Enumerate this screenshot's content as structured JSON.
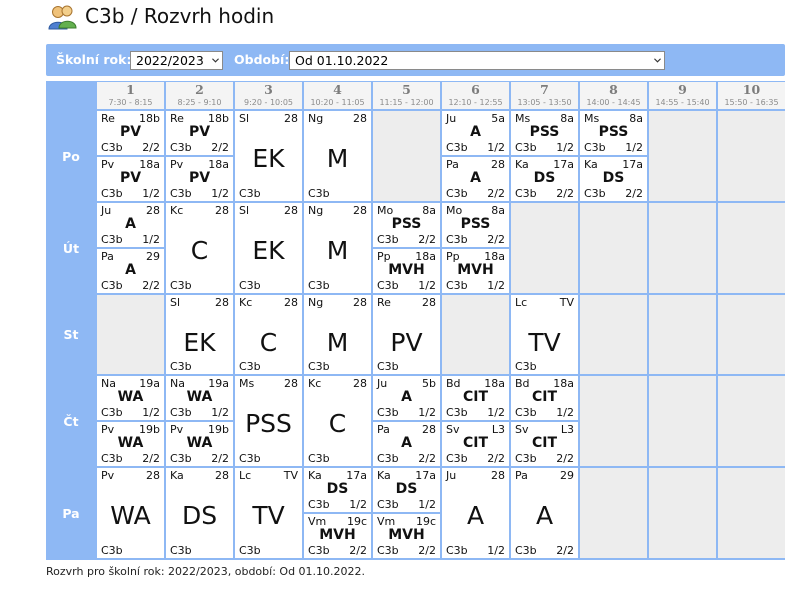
{
  "header": {
    "title": "C3b / Rozvrh hodin",
    "icon": "users-icon"
  },
  "filter": {
    "year_label": "Školní rok:",
    "year_value": "2022/2023",
    "period_label": "Období:",
    "period_value": "Od 01.10.2022"
  },
  "periods": [
    {
      "num": "1",
      "time": "7:30 - 8:15"
    },
    {
      "num": "2",
      "time": "8:25 - 9:10"
    },
    {
      "num": "3",
      "time": "9:20 - 10:05"
    },
    {
      "num": "4",
      "time": "10:20 - 11:05"
    },
    {
      "num": "5",
      "time": "11:15 - 12:00"
    },
    {
      "num": "6",
      "time": "12:10 - 12:55"
    },
    {
      "num": "7",
      "time": "13:05 - 13:50"
    },
    {
      "num": "8",
      "time": "14:00 - 14:45"
    },
    {
      "num": "9",
      "time": "14:55 - 15:40"
    },
    {
      "num": "10",
      "time": "15:50 - 16:35"
    }
  ],
  "days": [
    {
      "name": "Po",
      "slots": [
        [
          {
            "teacher": "Re",
            "room": "18b",
            "subject": "PV",
            "class": "C3b",
            "group": "2/2"
          },
          {
            "teacher": "Pv",
            "room": "18a",
            "subject": "PV",
            "class": "C3b",
            "group": "1/2"
          }
        ],
        [
          {
            "teacher": "Re",
            "room": "18b",
            "subject": "PV",
            "class": "C3b",
            "group": "2/2"
          },
          {
            "teacher": "Pv",
            "room": "18a",
            "subject": "PV",
            "class": "C3b",
            "group": "1/2"
          }
        ],
        [
          {
            "teacher": "Sl",
            "room": "28",
            "subject": "EK",
            "class": "C3b",
            "group": ""
          }
        ],
        [
          {
            "teacher": "Ng",
            "room": "28",
            "subject": "M",
            "class": "C3b",
            "group": ""
          }
        ],
        [],
        [
          {
            "teacher": "Ju",
            "room": "5a",
            "subject": "A",
            "class": "C3b",
            "group": "1/2"
          },
          {
            "teacher": "Pa",
            "room": "28",
            "subject": "A",
            "class": "C3b",
            "group": "2/2"
          }
        ],
        [
          {
            "teacher": "Ms",
            "room": "8a",
            "subject": "PSS",
            "class": "C3b",
            "group": "1/2"
          },
          {
            "teacher": "Ka",
            "room": "17a",
            "subject": "DS",
            "class": "C3b",
            "group": "2/2"
          }
        ],
        [
          {
            "teacher": "Ms",
            "room": "8a",
            "subject": "PSS",
            "class": "C3b",
            "group": "1/2"
          },
          {
            "teacher": "Ka",
            "room": "17a",
            "subject": "DS",
            "class": "C3b",
            "group": "2/2"
          }
        ],
        [],
        []
      ]
    },
    {
      "name": "Út",
      "slots": [
        [
          {
            "teacher": "Ju",
            "room": "28",
            "subject": "A",
            "class": "C3b",
            "group": "1/2"
          },
          {
            "teacher": "Pa",
            "room": "29",
            "subject": "A",
            "class": "C3b",
            "group": "2/2"
          }
        ],
        [
          {
            "teacher": "Kc",
            "room": "28",
            "subject": "C",
            "class": "C3b",
            "group": ""
          }
        ],
        [
          {
            "teacher": "Sl",
            "room": "28",
            "subject": "EK",
            "class": "C3b",
            "group": ""
          }
        ],
        [
          {
            "teacher": "Ng",
            "room": "28",
            "subject": "M",
            "class": "C3b",
            "group": ""
          }
        ],
        [
          {
            "teacher": "Mo",
            "room": "8a",
            "subject": "PSS",
            "class": "C3b",
            "group": "2/2"
          },
          {
            "teacher": "Pp",
            "room": "18a",
            "subject": "MVH",
            "class": "C3b",
            "group": "1/2"
          }
        ],
        [
          {
            "teacher": "Mo",
            "room": "8a",
            "subject": "PSS",
            "class": "C3b",
            "group": "2/2"
          },
          {
            "teacher": "Pp",
            "room": "18a",
            "subject": "MVH",
            "class": "C3b",
            "group": "1/2"
          }
        ],
        [],
        [],
        [],
        []
      ]
    },
    {
      "name": "St",
      "slots": [
        [],
        [
          {
            "teacher": "Sl",
            "room": "28",
            "subject": "EK",
            "class": "C3b",
            "group": ""
          }
        ],
        [
          {
            "teacher": "Kc",
            "room": "28",
            "subject": "C",
            "class": "C3b",
            "group": ""
          }
        ],
        [
          {
            "teacher": "Ng",
            "room": "28",
            "subject": "M",
            "class": "C3b",
            "group": ""
          }
        ],
        [
          {
            "teacher": "Re",
            "room": "28",
            "subject": "PV",
            "class": "C3b",
            "group": ""
          }
        ],
        [],
        [
          {
            "teacher": "Lc",
            "room": "TV",
            "subject": "TV",
            "class": "C3b",
            "group": ""
          }
        ],
        [],
        [],
        []
      ]
    },
    {
      "name": "Čt",
      "slots": [
        [
          {
            "teacher": "Na",
            "room": "19a",
            "subject": "WA",
            "class": "C3b",
            "group": "1/2"
          },
          {
            "teacher": "Pv",
            "room": "19b",
            "subject": "WA",
            "class": "C3b",
            "group": "2/2"
          }
        ],
        [
          {
            "teacher": "Na",
            "room": "19a",
            "subject": "WA",
            "class": "C3b",
            "group": "1/2"
          },
          {
            "teacher": "Pv",
            "room": "19b",
            "subject": "WA",
            "class": "C3b",
            "group": "2/2"
          }
        ],
        [
          {
            "teacher": "Ms",
            "room": "28",
            "subject": "PSS",
            "class": "C3b",
            "group": ""
          }
        ],
        [
          {
            "teacher": "Kc",
            "room": "28",
            "subject": "C",
            "class": "C3b",
            "group": ""
          }
        ],
        [
          {
            "teacher": "Ju",
            "room": "5b",
            "subject": "A",
            "class": "C3b",
            "group": "1/2"
          },
          {
            "teacher": "Pa",
            "room": "28",
            "subject": "A",
            "class": "C3b",
            "group": "2/2"
          }
        ],
        [
          {
            "teacher": "Bd",
            "room": "18a",
            "subject": "CIT",
            "class": "C3b",
            "group": "1/2"
          },
          {
            "teacher": "Sv",
            "room": "L3",
            "subject": "CIT",
            "class": "C3b",
            "group": "2/2"
          }
        ],
        [
          {
            "teacher": "Bd",
            "room": "18a",
            "subject": "CIT",
            "class": "C3b",
            "group": "1/2"
          },
          {
            "teacher": "Sv",
            "room": "L3",
            "subject": "CIT",
            "class": "C3b",
            "group": "2/2"
          }
        ],
        [],
        [],
        []
      ]
    },
    {
      "name": "Pa",
      "slots": [
        [
          {
            "teacher": "Pv",
            "room": "28",
            "subject": "WA",
            "class": "C3b",
            "group": ""
          }
        ],
        [
          {
            "teacher": "Ka",
            "room": "28",
            "subject": "DS",
            "class": "C3b",
            "group": ""
          }
        ],
        [
          {
            "teacher": "Lc",
            "room": "TV",
            "subject": "TV",
            "class": "C3b",
            "group": ""
          }
        ],
        [
          {
            "teacher": "Ka",
            "room": "17a",
            "subject": "DS",
            "class": "C3b",
            "group": "1/2"
          },
          {
            "teacher": "Vm",
            "room": "19c",
            "subject": "MVH",
            "class": "C3b",
            "group": "2/2"
          }
        ],
        [
          {
            "teacher": "Ka",
            "room": "17a",
            "subject": "DS",
            "class": "C3b",
            "group": "1/2"
          },
          {
            "teacher": "Vm",
            "room": "19c",
            "subject": "MVH",
            "class": "C3b",
            "group": "2/2"
          }
        ],
        [
          {
            "teacher": "Ju",
            "room": "28",
            "subject": "A",
            "class": "C3b",
            "group": "1/2"
          }
        ],
        [
          {
            "teacher": "Pa",
            "room": "29",
            "subject": "A",
            "class": "C3b",
            "group": "2/2"
          }
        ],
        [],
        [],
        []
      ]
    }
  ],
  "footer": "Rozvrh pro školní rok: 2022/2023, období: Od 01.10.2022."
}
